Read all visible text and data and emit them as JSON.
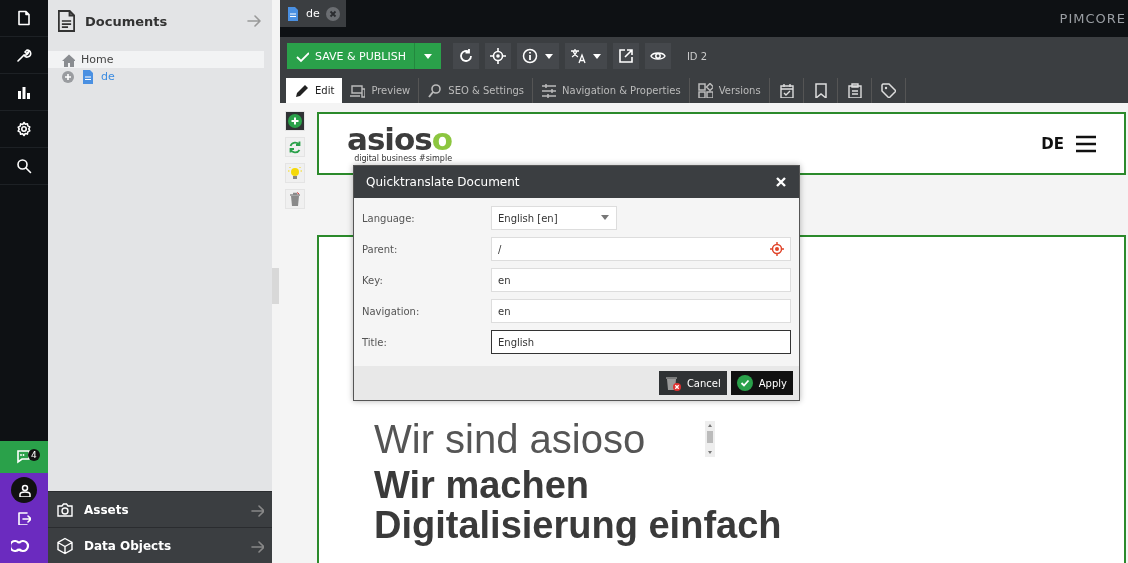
{
  "rail": {
    "chat_badge": "4"
  },
  "sidebar": {
    "title": "Documents",
    "tree": [
      {
        "label": "Home",
        "selected": true,
        "children": [
          {
            "label": "de",
            "selected": false
          }
        ]
      }
    ],
    "panels": [
      {
        "title": "Assets",
        "kind": "assets"
      },
      {
        "title": "Data Objects",
        "kind": "objects"
      }
    ]
  },
  "brand": "PIMCORE",
  "tabs": [
    {
      "label": "de",
      "selected": true
    }
  ],
  "toolbar": {
    "save_label": "SAVE & PUBLISH",
    "id_label": "ID 2"
  },
  "editor_tabs": [
    {
      "label": "Edit",
      "kind": "edit",
      "selected": true
    },
    {
      "label": "Preview",
      "kind": "preview",
      "selected": false
    },
    {
      "label": "SEO & Settings",
      "kind": "seo",
      "selected": false
    },
    {
      "label": "Navigation & Properties",
      "kind": "nav",
      "selected": false
    },
    {
      "label": "Versions",
      "kind": "versions",
      "selected": false
    },
    {
      "kind": "schedule",
      "selected": false
    },
    {
      "kind": "bookmark",
      "selected": false
    },
    {
      "kind": "notes",
      "selected": false
    },
    {
      "kind": "tag",
      "selected": false
    }
  ],
  "page": {
    "logo": {
      "text": "asios",
      "accent": "o",
      "tagline": "digital business #simple"
    },
    "language": "DE",
    "intro": "Wir sind asioso",
    "headline": "Wir machen Digitalisierung einfach"
  },
  "dialog": {
    "title": "Quicktranslate Document",
    "fields": [
      {
        "label": "Language:",
        "value": "English [en]",
        "kind": "select",
        "focused": false
      },
      {
        "label": "Parent:",
        "value": "/",
        "kind": "picker",
        "focused": false
      },
      {
        "label": "Key:",
        "value": "en",
        "kind": "text",
        "focused": false
      },
      {
        "label": "Navigation:",
        "value": "en",
        "kind": "text",
        "focused": false
      },
      {
        "label": "Title:",
        "value": "English",
        "kind": "text",
        "focused": true
      }
    ],
    "buttons": [
      {
        "label": "Cancel",
        "kind": "cancel"
      },
      {
        "label": "Apply",
        "kind": "apply"
      }
    ]
  }
}
